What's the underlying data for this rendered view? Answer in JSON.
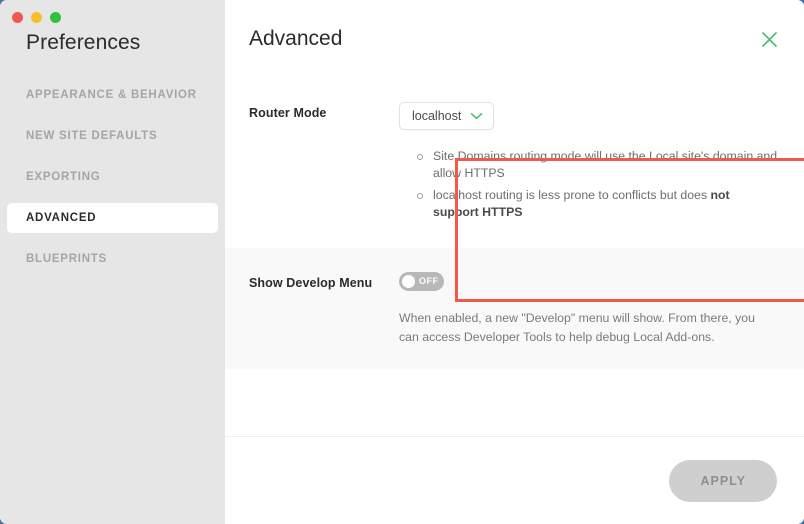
{
  "window": {
    "traffic_lights": [
      {
        "name": "close",
        "color": "#f0584f"
      },
      {
        "name": "minimize",
        "color": "#f7bd2e"
      },
      {
        "name": "maximize",
        "color": "#2fc13f"
      }
    ],
    "sidebar_title": "Preferences"
  },
  "sidebar": {
    "items": [
      {
        "label": "APPEARANCE & BEHAVIOR",
        "active": false
      },
      {
        "label": "NEW SITE DEFAULTS",
        "active": false
      },
      {
        "label": "EXPORTING",
        "active": false
      },
      {
        "label": "ADVANCED",
        "active": true
      },
      {
        "label": "BLUEPRINTS",
        "active": false
      }
    ]
  },
  "header": {
    "title": "Advanced",
    "close_icon": "close-x-icon",
    "close_icon_color": "#4dbd74"
  },
  "settings": {
    "router_mode": {
      "label": "Router Mode",
      "select_value": "localhost",
      "chevron_icon": "chevron-down-icon",
      "chevron_color": "#4dbd74",
      "options": [
        "localhost"
      ],
      "hints": [
        {
          "text_before": "Site Domains routing mode will use the Local site's domain and allow HTTPS",
          "bold": "",
          "text_after": ""
        },
        {
          "text_before": "localhost routing is less prone to conflicts but does ",
          "bold": "not support HTTPS",
          "text_after": ""
        }
      ]
    },
    "show_develop_menu": {
      "label": "Show Develop Menu",
      "toggle_state": "OFF",
      "toggle_on": false,
      "description": "When enabled, a new \"Develop\" menu will show. From there, you can access Developer Tools to help debug Local Add-ons."
    }
  },
  "footer": {
    "apply_label": "APPLY"
  },
  "annotation": {
    "color": "#ef5a4c",
    "name": "router-mode-highlight"
  }
}
